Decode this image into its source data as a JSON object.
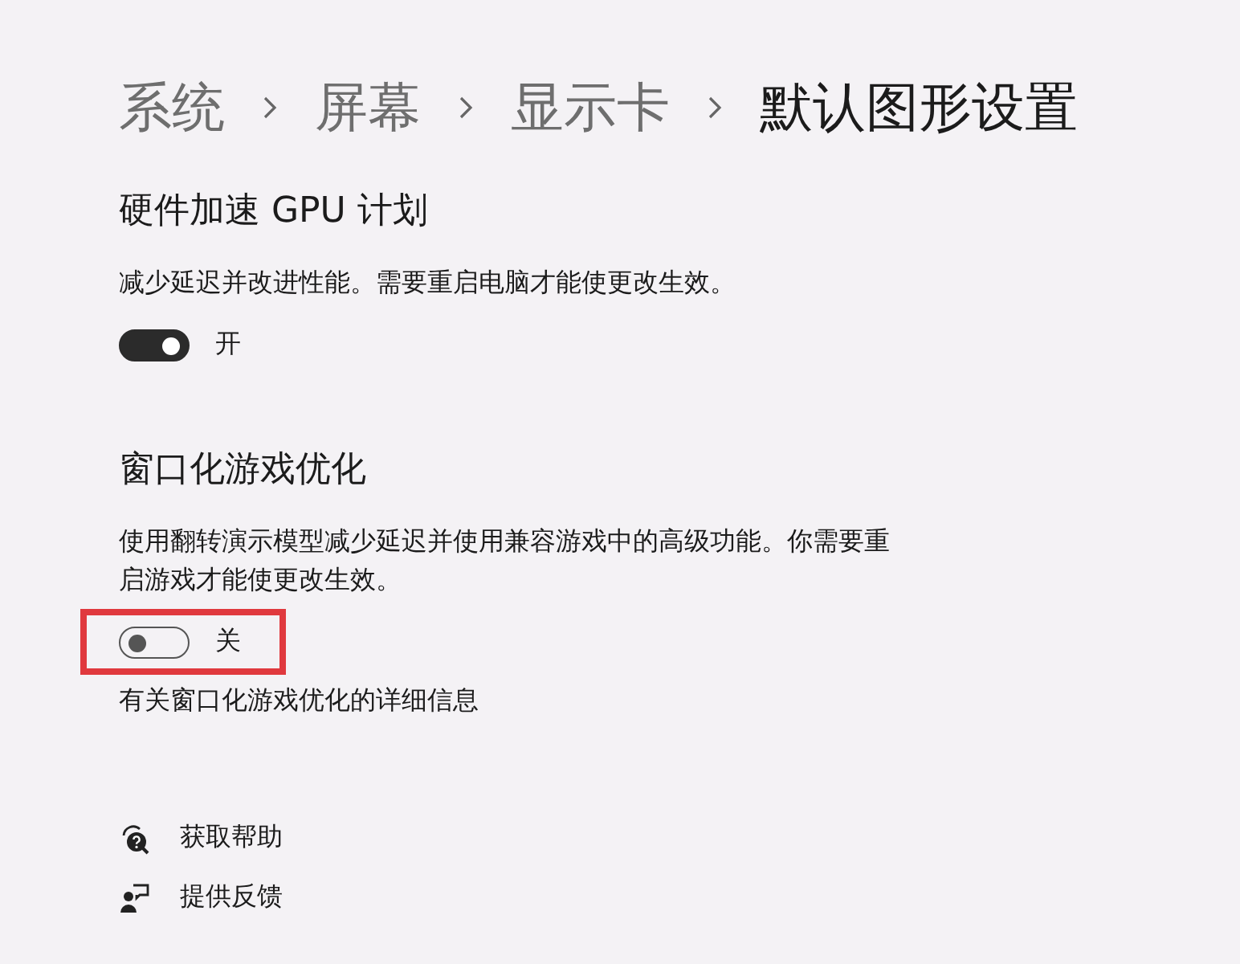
{
  "breadcrumb": [
    {
      "label": "系统",
      "current": false
    },
    {
      "label": "屏幕",
      "current": false
    },
    {
      "label": "显示卡",
      "current": false
    },
    {
      "label": "默认图形设置",
      "current": true
    }
  ],
  "settings": [
    {
      "title": "硬件加速 GPU 计划",
      "description": "减少延迟并改进性能。需要重启电脑才能使更改生效。",
      "on": true,
      "state_label": "开",
      "highlighted": false
    },
    {
      "title": "窗口化游戏优化",
      "description": "使用翻转演示模型减少延迟并使用兼容游戏中的高级功能。你需要重启游戏才能使更改生效。",
      "on": false,
      "state_label": "关",
      "highlighted": true,
      "link": "有关窗口化游戏优化的详细信息"
    }
  ],
  "footer_links": [
    {
      "kind": "help",
      "label": "获取帮助"
    },
    {
      "kind": "feedback",
      "label": "提供反馈"
    }
  ]
}
